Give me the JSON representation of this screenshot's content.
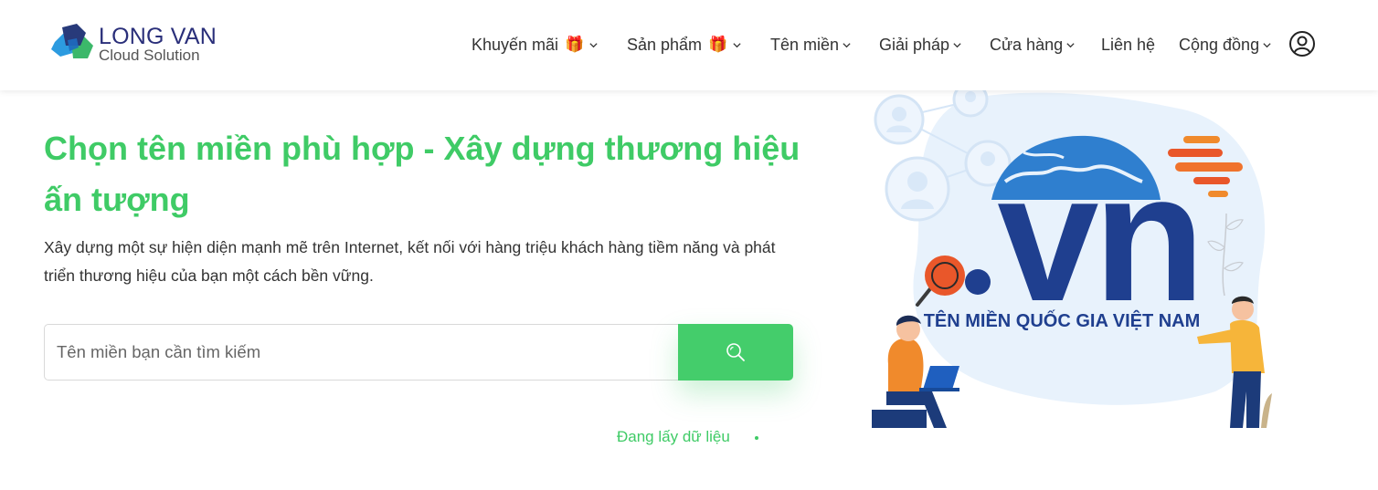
{
  "brand": {
    "name": "LONG VAN",
    "tagline": "Cloud Solution"
  },
  "nav": {
    "items": [
      {
        "label": "Khuyến mãi",
        "gift": true,
        "dropdown": true
      },
      {
        "label": "Sản phẩm",
        "gift": true,
        "dropdown": true
      },
      {
        "label": "Tên miền",
        "gift": false,
        "dropdown": true
      },
      {
        "label": "Giải pháp",
        "gift": false,
        "dropdown": true
      },
      {
        "label": "Cửa hàng",
        "gift": false,
        "dropdown": true
      },
      {
        "label": "Liên hệ",
        "gift": false,
        "dropdown": false
      },
      {
        "label": "Cộng đồng",
        "gift": false,
        "dropdown": true
      }
    ],
    "gift_glyph": "🎁",
    "account_icon": "user-circle-icon"
  },
  "hero": {
    "title": "Chọn tên miền phù hợp - Xây dựng thương hiệu ấn tượng",
    "description": "Xây dựng một sự hiện diện mạnh mẽ trên Internet, kết nối với hàng triệu khách hàng tiềm năng và phát triển thương hiệu của bạn một cách bền vững.",
    "search_placeholder": "Tên miền bạn cần tìm kiếm",
    "search_value": "",
    "search_icon": "search-icon",
    "loading_text": "Đang lấy dữ liệu"
  },
  "illustration": {
    "domain_text": "vn",
    "caption": "TÊN MIỀN QUỐC GIA VIỆT NAM"
  },
  "colors": {
    "accent_green": "#44cd6b",
    "title_green": "#3fcb66",
    "brand_navy": "#1f3f8f",
    "logo_text": "#2a2f7a"
  }
}
